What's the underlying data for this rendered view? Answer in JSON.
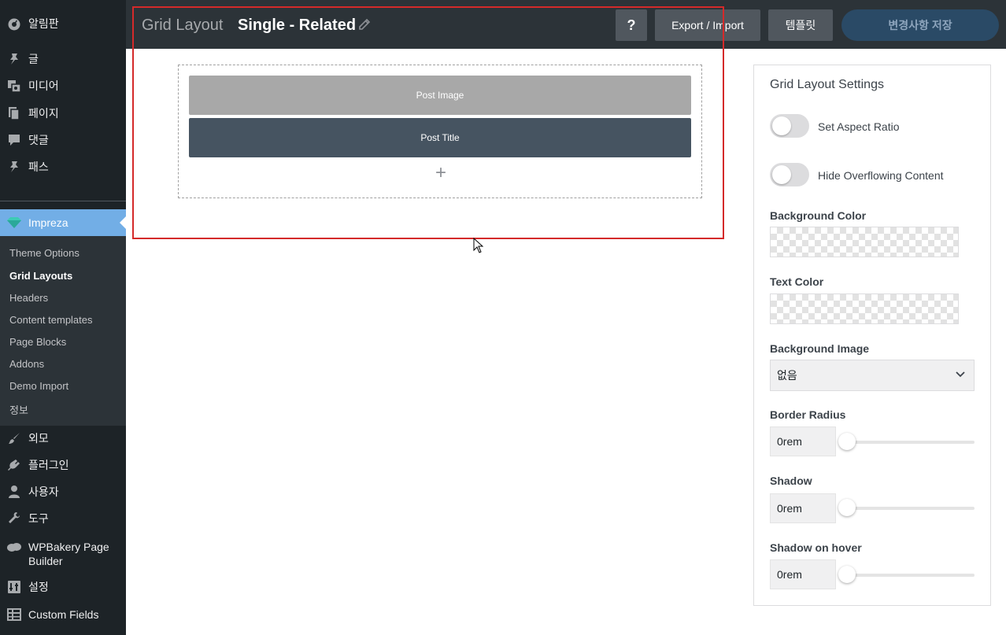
{
  "sidebar": {
    "items": [
      {
        "label": "알림판",
        "icon": "dashboard-icon"
      },
      {
        "label": "글",
        "icon": "pin-icon"
      },
      {
        "label": "미디어",
        "icon": "media-icon"
      },
      {
        "label": "페이지",
        "icon": "pages-icon"
      },
      {
        "label": "댓글",
        "icon": "comments-icon"
      },
      {
        "label": "패스",
        "icon": "pin-icon"
      }
    ],
    "impreza": {
      "label": "Impreza",
      "icon": "impreza-icon"
    },
    "submenu": [
      "Theme Options",
      "Grid Layouts",
      "Headers",
      "Content templates",
      "Page Blocks",
      "Addons",
      "Demo Import",
      "정보"
    ],
    "bottom_items": [
      {
        "label": "외모",
        "icon": "brush-icon"
      },
      {
        "label": "플러그인",
        "icon": "plugin-icon"
      },
      {
        "label": "사용자",
        "icon": "user-icon"
      },
      {
        "label": "도구",
        "icon": "wrench-icon"
      },
      {
        "label": "WPBakery Page Builder",
        "icon": "wpbakery-icon"
      },
      {
        "label": "설정",
        "icon": "settings-icon"
      },
      {
        "label": "Custom Fields",
        "icon": "table-icon"
      }
    ]
  },
  "header": {
    "section_title": "Grid Layout",
    "layout_name": "Single - Related",
    "help_label": "?",
    "export_label": "Export / Import",
    "templates_label": "템플릿",
    "save_label": "변경사항 저장"
  },
  "canvas": {
    "elements": [
      "Post Image",
      "Post Title"
    ],
    "add_label": "+"
  },
  "settings": {
    "title": "Grid Layout Settings",
    "aspect_ratio_label": "Set Aspect Ratio",
    "aspect_ratio_on": false,
    "hide_overflow_label": "Hide Overflowing Content",
    "hide_overflow_on": false,
    "bg_color_label": "Background Color",
    "text_color_label": "Text Color",
    "bg_image_label": "Background Image",
    "bg_image_value": "없음",
    "border_radius_label": "Border Radius",
    "border_radius_value": "0rem",
    "shadow_label": "Shadow",
    "shadow_value": "0rem",
    "shadow_hover_label": "Shadow on hover",
    "shadow_hover_value": "0rem"
  },
  "colors": {
    "sidebar_bg": "#1d2327",
    "active_menu": "#72aee6",
    "header_bg": "#2c3338",
    "post_title_bg": "#465461",
    "post_image_bg": "#a8a8a8",
    "highlight_frame": "#d42a2a"
  }
}
